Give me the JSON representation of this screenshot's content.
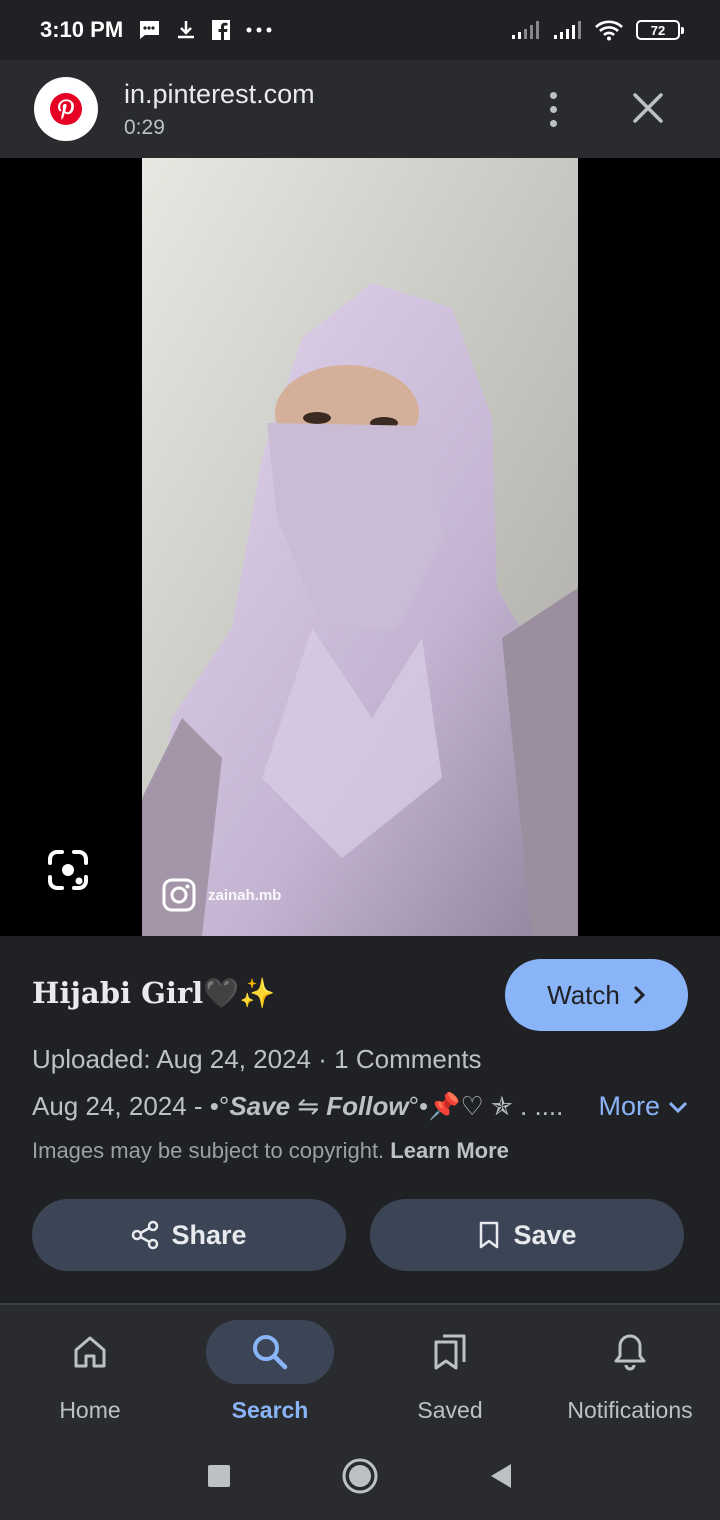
{
  "status_bar": {
    "time": "3:10 PM",
    "battery_level": "72",
    "left_icons": [
      "message-icon",
      "download-icon",
      "facebook-icon",
      "more-dots-icon"
    ],
    "right_icons": [
      "signal-icon",
      "signal-icon",
      "wifi-icon",
      "battery-icon"
    ]
  },
  "header": {
    "site_name": "in.pinterest.com",
    "duration": "0:29"
  },
  "media": {
    "watermark_handle": "zainah.mb"
  },
  "result": {
    "title": "Hijabi Girl🖤✨",
    "watch_label": "Watch",
    "uploaded": "Uploaded: Aug 24, 2024",
    "comments": "1 Comments",
    "description_prefix": "Aug 24, 2024 - •°",
    "description_save": "Save",
    "description_arrow": " ⇋ ",
    "description_follow": "Follow",
    "description_suffix": "°•📌♡ ✯ . ....",
    "more_label": "More",
    "copyright_text": "Images may be subject to copyright.",
    "learn_more": "Learn More",
    "share_label": "Share",
    "save_label": "Save"
  },
  "bottom_nav": {
    "items": [
      {
        "label": "Home",
        "icon": "home-icon",
        "active": false
      },
      {
        "label": "Search",
        "icon": "search-icon",
        "active": true
      },
      {
        "label": "Saved",
        "icon": "saved-icon",
        "active": false
      },
      {
        "label": "Notifications",
        "icon": "bell-icon",
        "active": false
      }
    ]
  },
  "colors": {
    "accent": "#8ab4f8",
    "background": "#202124",
    "pill": "#3c4555",
    "pinterest_red": "#e60023"
  }
}
